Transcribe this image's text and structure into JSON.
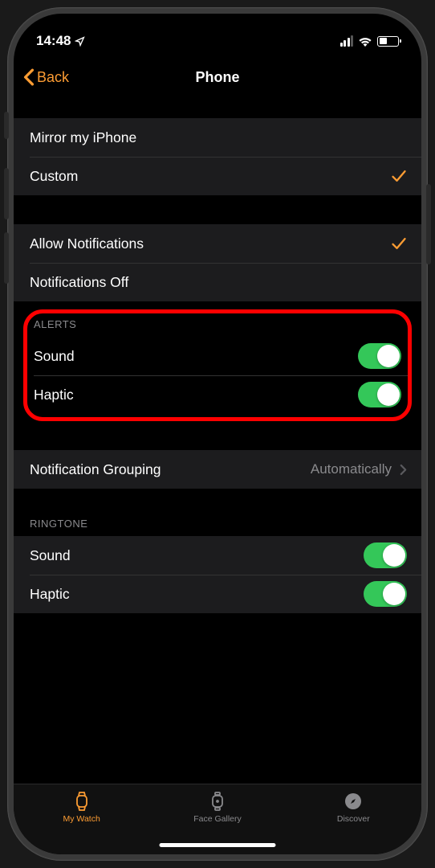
{
  "status": {
    "time": "14:48"
  },
  "nav": {
    "back": "Back",
    "title": "Phone"
  },
  "group1": {
    "mirror": "Mirror my iPhone",
    "custom": "Custom"
  },
  "group2": {
    "allow": "Allow Notifications",
    "off": "Notifications Off"
  },
  "alerts": {
    "header": "ALERTS",
    "sound": "Sound",
    "haptic": "Haptic",
    "sound_on": true,
    "haptic_on": true
  },
  "grouping": {
    "label": "Notification Grouping",
    "value": "Automatically"
  },
  "ringtone": {
    "header": "RINGTONE",
    "sound": "Sound",
    "haptic": "Haptic",
    "sound_on": true,
    "haptic_on": true
  },
  "tabs": {
    "watch": "My Watch",
    "gallery": "Face Gallery",
    "discover": "Discover"
  },
  "colors": {
    "accent": "#fc9c33",
    "toggle_on": "#34c759",
    "highlight": "#ff0000"
  }
}
